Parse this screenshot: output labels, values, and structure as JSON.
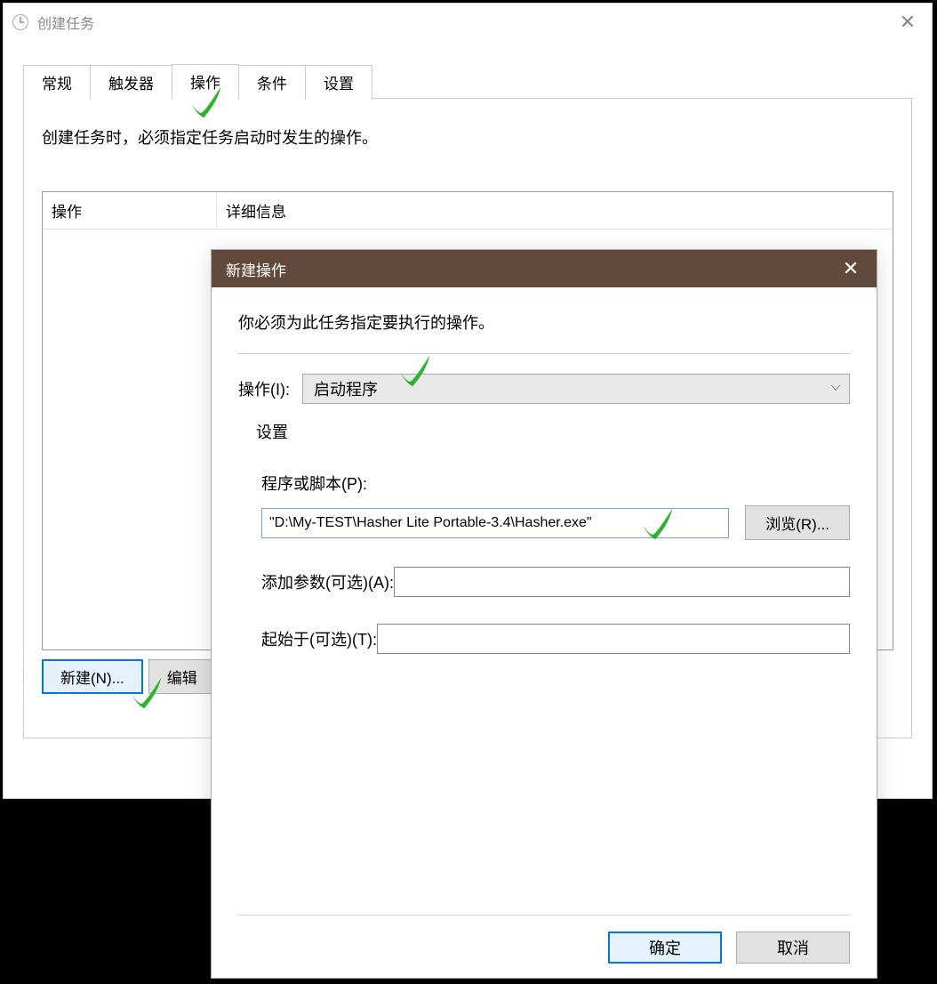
{
  "parent": {
    "title": "创建任务",
    "tabs": {
      "general": "常规",
      "triggers": "触发器",
      "actions": "操作",
      "conditions": "条件",
      "settings": "设置"
    },
    "desc": "创建任务时，必须指定任务启动时发生的操作。",
    "cols": {
      "action": "操作",
      "details": "详细信息"
    },
    "buttons": {
      "new": "新建(N)...",
      "edit": "编辑"
    }
  },
  "child": {
    "title": "新建操作",
    "desc": "你必须为此任务指定要执行的操作。",
    "action_label": "操作(I):",
    "action_value": "启动程序",
    "settings_label": "设置",
    "program_label": "程序或脚本(P):",
    "program_value": "\"D:\\My-TEST\\Hasher Lite Portable-3.4\\Hasher.exe\"",
    "browse": "浏览(R)...",
    "args_label": "添加参数(可选)(A):",
    "args_value": "",
    "startin_label": "起始于(可选)(T):",
    "startin_value": "",
    "ok": "确定",
    "cancel": "取消"
  }
}
